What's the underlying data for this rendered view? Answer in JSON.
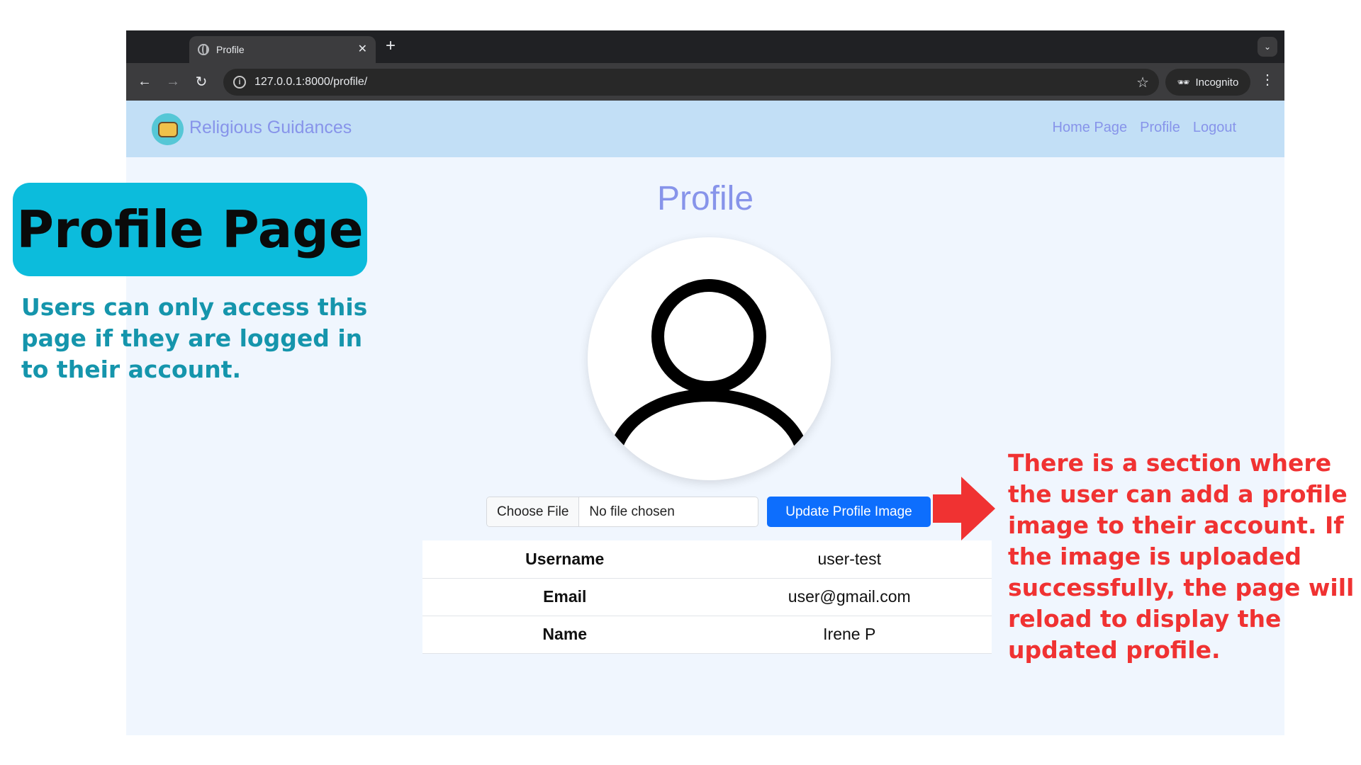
{
  "browser": {
    "tab_title": "Profile",
    "url": "127.0.0.1:8000/profile/",
    "incognito_label": "Incognito"
  },
  "site": {
    "brand": "Religious Guidances",
    "nav_links": [
      "Home Page",
      "Profile",
      "Logout"
    ]
  },
  "profile": {
    "title": "Profile",
    "file_input": {
      "button_label": "Choose File",
      "status": "No file chosen"
    },
    "update_button": "Update Profile Image",
    "fields": [
      {
        "label": "Username",
        "value": "user-test"
      },
      {
        "label": "Email",
        "value": "user@gmail.com"
      },
      {
        "label": "Name",
        "value": "Irene P"
      }
    ]
  },
  "annotations": {
    "title": "Profile Page",
    "left_note": "Users can only access this page if they are logged in to their account.",
    "right_note": "There is a section where the user can add a profile image to their account. If the image is uploaded successfully, the page will reload to display the updated profile."
  },
  "colors": {
    "nav_bg": "#c2dff6",
    "accent": "#8794ea",
    "primary_button": "#0d6efd",
    "annotation_box": "#0cbcdc",
    "annotation_left": "#1595ac",
    "annotation_right": "#f03232"
  }
}
